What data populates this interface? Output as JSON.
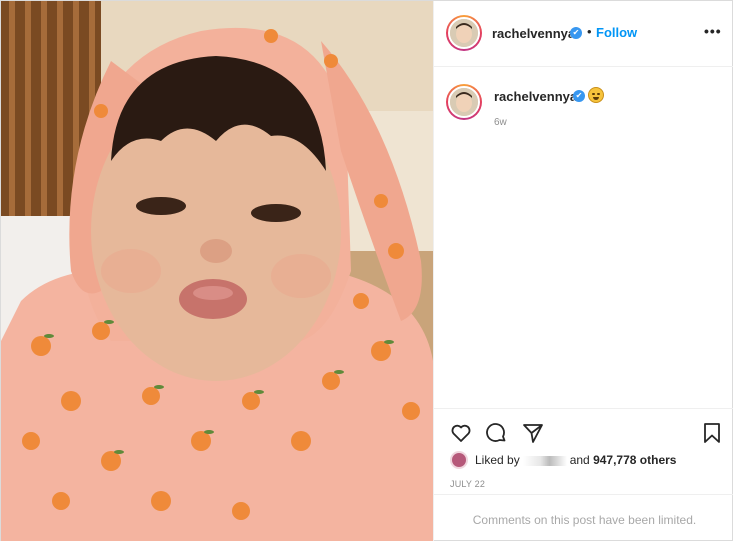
{
  "post": {
    "username": "rachelvennya",
    "follow_label": "Follow",
    "separator": "•",
    "more_label": "•••",
    "caption_username": "rachelvennya",
    "caption_emoji": "grimacing-face-emoji",
    "time_ago": "6w",
    "liked_by_prefix": "Liked by",
    "liked_by_suffix": "and",
    "likes_count": "947,778 others",
    "date": "JULY 22",
    "comments_notice": "Comments on this post have been limited."
  },
  "icons": {
    "verified": "verified-badge-icon",
    "like": "heart-icon",
    "comment": "comment-bubble-icon",
    "share": "paper-plane-icon",
    "save": "bookmark-icon"
  },
  "colors": {
    "accent": "#0095f6",
    "verified": "#3897f0",
    "muted": "#8e8e8e",
    "border": "#efefef"
  }
}
